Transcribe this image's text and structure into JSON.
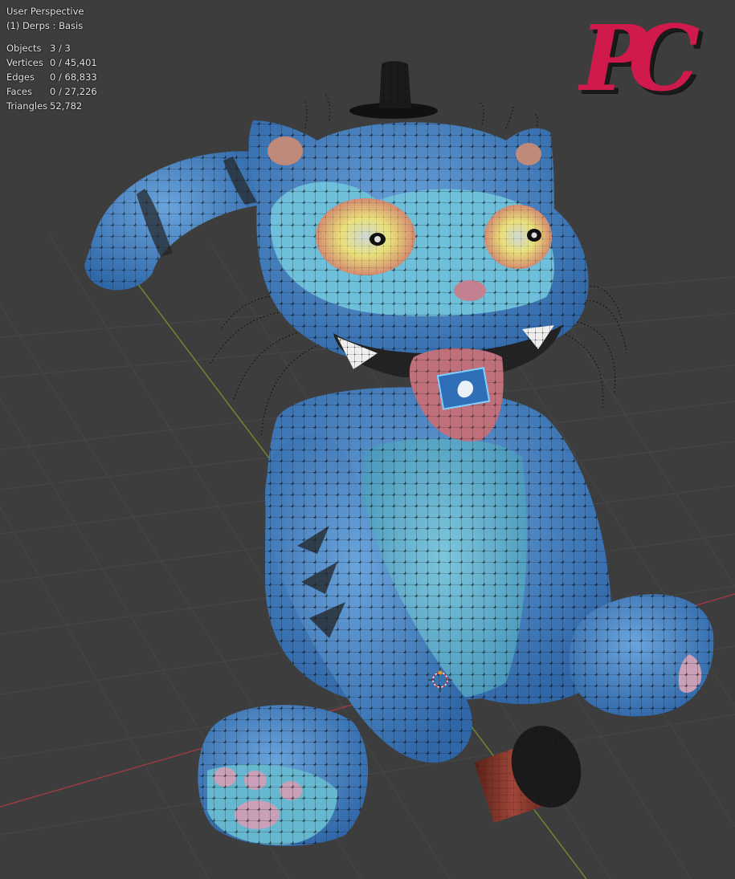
{
  "viewport": {
    "view_name": "User Perspective",
    "object_info": "(1) Derps : Basis",
    "stats": [
      {
        "label": "Objects",
        "value": "3 / 3"
      },
      {
        "label": "Vertices",
        "value": "0 / 45,401"
      },
      {
        "label": "Edges",
        "value": "0 / 68,833"
      },
      {
        "label": "Faces",
        "value": "0 / 27,226"
      },
      {
        "label": "Triangles",
        "value": "52,782"
      }
    ]
  },
  "logo": {
    "text": "PC",
    "color": "#d01a4b"
  },
  "colors": {
    "background": "#3d3d3d",
    "grid": "#474747",
    "axis_x": "#9a3b45",
    "axis_y": "#6a8a2a",
    "body": "#4a86c8",
    "belly": "#5fb0cc",
    "wire": "#111111",
    "eye": "#e2c27a",
    "tongue": "#c0707a",
    "cupcake": "#8a3a30"
  },
  "icons": {
    "origin": "3d-cursor-icon"
  }
}
